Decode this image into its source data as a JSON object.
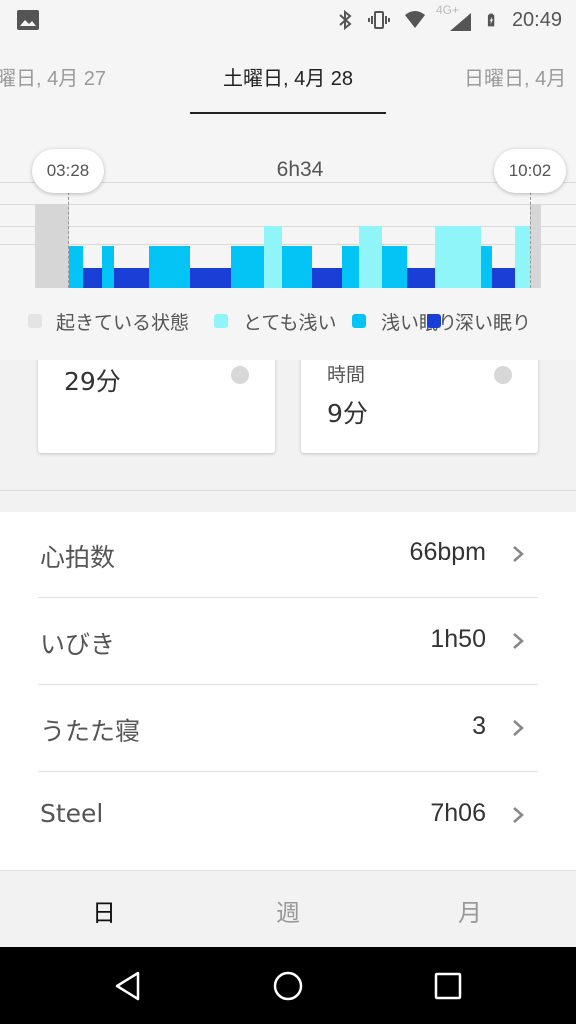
{
  "status_bar": {
    "time": "20:49",
    "network": "4G+",
    "icons": [
      "image-icon",
      "bluetooth-icon",
      "vibrate-icon",
      "wifi-icon",
      "signal-icon",
      "battery-icon"
    ]
  },
  "date_tabs": {
    "prev": "曜日, 4月 27",
    "current": "土曜日, 4月 28",
    "next": "日曜日, 4月"
  },
  "sleep_chart": {
    "start_time": "03:28",
    "end_time": "10:02",
    "duration": "6h34"
  },
  "legend": [
    {
      "label": "起きている状態",
      "color": "#e4e4e4"
    },
    {
      "label": "とても浅い",
      "color": "#8ff5f8"
    },
    {
      "label": "浅い眠り",
      "color": "#03c4f5"
    },
    {
      "label": "深い眠り",
      "color": "#1a3fd6"
    }
  ],
  "cards": {
    "left": {
      "value": "29分"
    },
    "right": {
      "label": "時間",
      "value": "9分"
    }
  },
  "metrics": [
    {
      "label": "心拍数",
      "value": "66bpm"
    },
    {
      "label": "いびき",
      "value": "1h50"
    },
    {
      "label": "うたた寝",
      "value": "3"
    },
    {
      "label": "Steel",
      "value": "7h06"
    }
  ],
  "period_tabs": {
    "day": "日",
    "week": "週",
    "month": "月"
  },
  "colors": {
    "awake": "#d6d6d6",
    "very_light": "#8ff5f8",
    "light": "#03c4f5",
    "deep": "#1a3fd6"
  }
}
